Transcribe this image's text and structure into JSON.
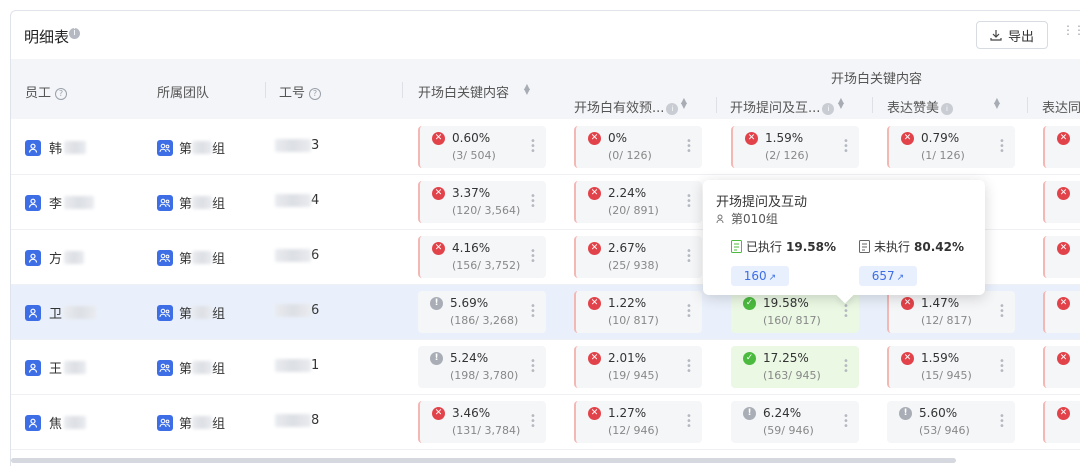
{
  "page": {
    "title": "明细表",
    "export_label": "导出"
  },
  "header": {
    "group_title": "开场白关键内容",
    "columns": {
      "employee": "员工",
      "team": "所属团队",
      "id": "工号",
      "m1": "开场白关键内容",
      "m2": "开场白有效预...",
      "m3": "开场提问及互...",
      "m4": "表达赞美",
      "m5": "表达同"
    }
  },
  "rows": [
    {
      "name": "韩",
      "team_prefix": "第",
      "team_suffix": "组",
      "id_suffix": "3",
      "m1": {
        "status": "red",
        "pct": "0.60%",
        "frac": "(3/ 504)"
      },
      "m2": {
        "status": "red",
        "pct": "0%",
        "frac": "(0/ 126)"
      },
      "m3": {
        "status": "red",
        "pct": "1.59%",
        "frac": "(2/ 126)"
      },
      "m4": {
        "status": "red",
        "pct": "0.79%",
        "frac": "(1/ 126)"
      }
    },
    {
      "name": "李",
      "team_prefix": "第",
      "team_suffix": "组",
      "id_suffix": "4",
      "m1": {
        "status": "red",
        "pct": "3.37%",
        "frac": "(120/ 3,564)"
      },
      "m2": {
        "status": "red",
        "pct": "2.24%",
        "frac": "(20/ 891)"
      }
    },
    {
      "name": "方",
      "team_prefix": "第",
      "team_suffix": "组",
      "id_suffix": "6",
      "m1": {
        "status": "red",
        "pct": "4.16%",
        "frac": "(156/ 3,752)"
      },
      "m2": {
        "status": "red",
        "pct": "2.67%",
        "frac": "(25/ 938)"
      }
    },
    {
      "name": "卫",
      "team_prefix": "第",
      "team_suffix": "组",
      "id_suffix": "6",
      "m1": {
        "status": "gray",
        "pct": "5.69%",
        "frac": "(186/ 3,268)"
      },
      "m2": {
        "status": "red",
        "pct": "1.22%",
        "frac": "(10/ 817)"
      },
      "m3": {
        "status": "green",
        "pct": "19.58%",
        "frac": "(160/ 817)"
      },
      "m4": {
        "status": "red",
        "pct": "1.47%",
        "frac": "(12/ 817)"
      }
    },
    {
      "name": "王",
      "team_prefix": "第",
      "team_suffix": "组",
      "id_suffix": "1",
      "m1": {
        "status": "gray",
        "pct": "5.24%",
        "frac": "(198/ 3,780)"
      },
      "m2": {
        "status": "red",
        "pct": "2.01%",
        "frac": "(19/ 945)"
      },
      "m3": {
        "status": "green",
        "pct": "17.25%",
        "frac": "(163/ 945)"
      },
      "m4": {
        "status": "red",
        "pct": "1.59%",
        "frac": "(15/ 945)"
      }
    },
    {
      "name": "焦",
      "team_prefix": "第",
      "team_suffix": "组",
      "id_suffix": "8",
      "m1": {
        "status": "red",
        "pct": "3.46%",
        "frac": "(131/ 3,784)"
      },
      "m2": {
        "status": "red",
        "pct": "1.27%",
        "frac": "(12/ 946)"
      },
      "m3": {
        "status": "gray",
        "pct": "6.24%",
        "frac": "(59/ 946)"
      },
      "m4": {
        "status": "gray",
        "pct": "5.60%",
        "frac": "(53/ 946)"
      }
    }
  ],
  "tooltip": {
    "title": "开场提问及互动",
    "team": "第010组",
    "executed_label": "已执行",
    "executed_pct": "19.58%",
    "not_executed_label": "未执行",
    "not_executed_pct": "80.42%",
    "executed_count": "160",
    "not_executed_count": "657"
  },
  "colors": {
    "accent": "#3d6ee6",
    "fail": "#e2434a",
    "pass": "#4cba3e",
    "neutral": "#a9adb5",
    "highlight_row": "#eaf0fb"
  }
}
